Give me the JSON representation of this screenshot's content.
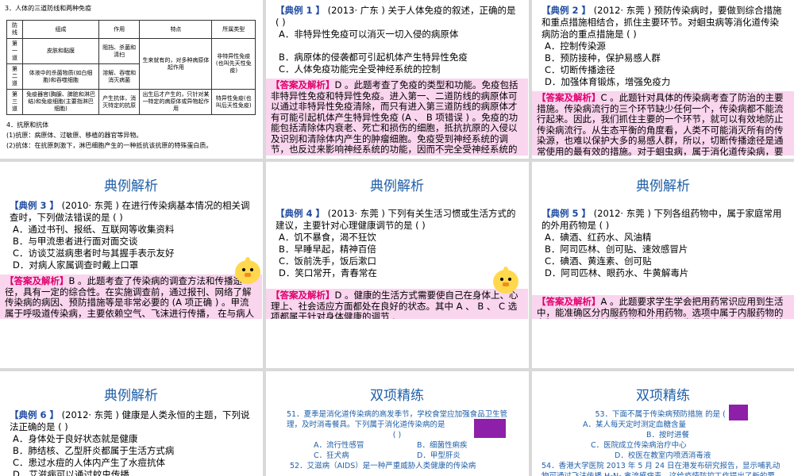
{
  "slide1": {
    "heading": "3．人体的三道防线和两种免疫",
    "table": {
      "headers": [
        "防线",
        "组成",
        "作用",
        "特点",
        "所属类型"
      ],
      "rows": [
        [
          "第一道",
          "皮肤和黏膜",
          "阻挡、杀菌和清扫",
          "生来就有的，对多种病原体起作用",
          "非特异性免疫(也叫先天性免疫)"
        ],
        [
          "第二道",
          "体液中的杀菌物质(如白细胞)和吞噬细胞",
          "溶解、吞噬和消灭病菌",
          "",
          ""
        ],
        [
          "第三道",
          "免疫器官(胸腺、脾脏和淋巴结)和免疫细胞(主要指淋巴细胞)",
          "产生抗体，消灭特定的抗原",
          "出生后才产生的，只针对某一特定的病原体或异物起作用",
          "特异性免疫(也叫后天性免疫)"
        ]
      ]
    },
    "list": [
      "4．抗原和抗体",
      "(1)抗原：病原体、过敏原、移植的器官等异物。",
      "(2)抗体：在抗原刺激下，淋巴细胞产生的一种抵抗该抗原的特殊蛋白质。"
    ]
  },
  "slide2": {
    "tag": "【典例 1 】",
    "question": "(2013· 广东 ) 关于人体免疫的叙述，正确的是 (     )",
    "options": [
      "A．非特异性免疫可以消灭一切入侵的病原体",
      "B．病原体的侵袭都可引起机体产生特异性免疫",
      "C．人体免疫功能完全受神经系统的控制"
    ],
    "answer_tag": "【答案及解析】",
    "answer": "D 。此题考查了免疫的类型和功能。免疫包括非特异性免疫和特异性免疫。进入第一、二道防线的病原体可以通过非特异性免疫清除，而只有进入第三道防线的病原体才有可能引起机体产生特异性免疫 (A 、 B 项错误 ) 。免疫的功能包括清除体内衰老、死亡和损伤的细胞，抵抗抗原的入侵以及识别和清除体内产生的肿瘤细胞。免疫受到神经系统的调节，也反过来影响神经系统的功能，因而不完全受神经系统的控制 (C 项错误 )"
  },
  "slide3": {
    "tag": "【典例 2 】",
    "question": "(2012· 东莞 ) 预防传染病时，要做到综合措施和重点措施相结合，抓住主要环节。对蛔虫病等消化道传染病防治的重点措施是 (     )",
    "options": [
      "A．控制传染源",
      "B．预防接种，保护易感人群",
      "C．切断传播途径",
      "D．加强体育锻炼，增强免疫力"
    ],
    "answer_tag": "【答案及解析】",
    "answer": "C 。此题针对具体的传染病考查了防治的主要措施。传染病流行的三个环节缺少任何一个，传染病都不能流行起来。因此，我们抓住主要的一个环节，就可以有效地防止传染病流行。从生态平衡的角度看，人类不可能消灭所有的传染源，也难以保护大多的易感人群，所以，切断传播途径是通常使用的最有效的措施。对于蛔虫病，属于消化道传染病，要注意饮食、饮水的卫生，进而切断传播途径，减少感染的机会"
  },
  "slide4": {
    "title": "典例解析",
    "tag": "【典例 3 】",
    "question": "(2010· 东莞 ) 在进行传染病基本情况的相关调查时，下列做法错误的是 (     )",
    "options": [
      "A．通过书刊、报纸、互联网等收集资料",
      "B．与甲流患者进行面对面交谈",
      "C．访谈艾滋病患者时与其握手表示友好",
      "D．对病人家属调查时戴上口罩"
    ],
    "answer_tag": "【答案及解析】",
    "answer": "B 。此题考查了传染病的调查方法和传播途径，具有一定的综合性。在实施调查前，通过报刊、网络了解传染病的病因、预防措施等是非常必要的 (A 项正确 ) 。甲流属于呼吸道传染病，主要依赖空气、飞沫进行传播，    在与病人家属交谈时要戴上口罩，避免传染 (D 项正确 ) 。与甲流患者交谈时要在 2 米以外的距离才安全。艾滋病通过性接触、血液和母婴之间进行传播，握手是安全的 (C 项正确 ) 。"
  },
  "slide5": {
    "title": "典例解析",
    "tag": "【典例 4 】",
    "question": "(2013· 东莞 ) 下列有关生活习惯或生活方式的建议，主要针对心理健康调节的是 (     )",
    "options": [
      "A．饥不暴食，渴不狂饮",
      "B．早睡早起，精神百倍",
      "C．饭前洗手，饭后漱口",
      "D．笑口常开，青春常在"
    ],
    "answer_tag": "【答案及解析】",
    "answer": "D 。健康的生活方式需要使自己在身体上、心理上、社会适应方面都处在良好的状态。其中 A 、 B 、 C 选项都属于针对身体健康的调节 ."
  },
  "slide6": {
    "title": "典例解析",
    "tag": "【典例 5 】",
    "question": "(2012· 东莞 ) 下列各组药物中，属于家庭常用的外用药物是 (     )",
    "options": [
      "A．碘酒、红药水、风油精",
      "B．阿司匹林、创可贴、速效感冒片",
      "C．碘酒、黄连素、创可贴",
      "D．阿司匹林、眼药水、牛黄解毒片"
    ],
    "answer_tag": "【答案及解析】",
    "answer": "A 。此题要求学生学会把用药常识应用到生活中，能准确区分内服药物和外用药物。选项中属于内服药物的有阿司匹林、速效感冒片、黄连素、牛黄解毒片；属于外用药物的有碘酒、红药水、风油精、创可贴、眼药水。"
  },
  "slide7": {
    "title": "典例解析",
    "tag": "【典例 6 】",
    "question": "(2012· 东莞 ) 健康是人类永恒的主题，下列说法正确的是 (     )",
    "options": [
      "A．身体处于良好状态就是健康",
      "B．肺结核、乙型肝炎都属于生活方式病",
      "C．患过水痘的人体内产生了水痘抗体",
      "D．艾滋病可以通过蚊虫传播"
    ]
  },
  "slide8": {
    "title": "双项精练",
    "q51": "51．夏季是消化道传染病的高发季节，学校食堂应加强食品卫生管理，及时消毒餐具。下列属于消化道传染病的是",
    "q51_paren": "(     )",
    "q51_opts": [
      "A．流行性感冒",
      "B．细菌性痢疾",
      "C．狂犬病",
      "D．甲型肝炎"
    ],
    "q52": "52．艾滋病（AIDS）是一种严重威胁人类健康的传染病"
  },
  "slide9": {
    "title": "双项精练",
    "q53": "53．下面不属于传染病预防措施 的是 (     )",
    "q53_opts": [
      "A．某人每天定时测定血糖含量",
      "B．按时进餐",
      "C．医院成立传染病治疗中心",
      "D．校医在教室内喷洒消毒液"
    ],
    "q54": "54．香港大学医院 2013 年 5 月 24 日在港发布研究报告，显示哺乳动物可通过飞沫传播 H₇N₉ 禽流感病毒。这给疫情防控工作提出了新的要求，以下说法错误的是 (     )"
  },
  "colors": {
    "title_blue": "#1f5fa8",
    "tag_blue": "#1f4aa0",
    "answer_pink": "#f9d5ee",
    "answer_tag": "#e0006d",
    "mask_purple": "#8e1fa8"
  }
}
